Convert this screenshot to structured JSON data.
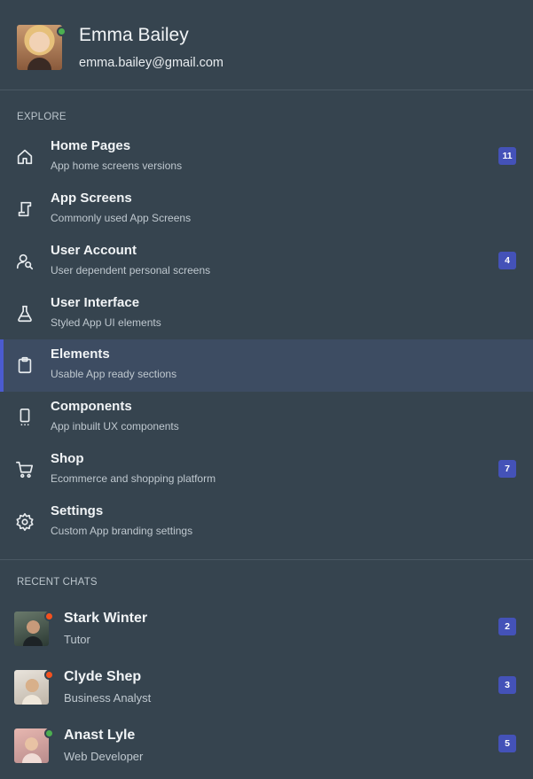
{
  "profile": {
    "name": "Emma Bailey",
    "email": "emma.bailey@gmail.com",
    "status_color": "#4caf50"
  },
  "explore": {
    "label": "EXPLORE",
    "items": [
      {
        "icon": "home-icon",
        "title": "Home Pages",
        "subtitle": "App home screens versions",
        "badge": "11"
      },
      {
        "icon": "screen-icon",
        "title": "App Screens",
        "subtitle": "Commonly used App Screens",
        "badge": ""
      },
      {
        "icon": "user-search-icon",
        "title": "User Account",
        "subtitle": "User dependent personal screens",
        "badge": "4"
      },
      {
        "icon": "flask-icon",
        "title": "User Interface",
        "subtitle": "Styled App UI elements",
        "badge": ""
      },
      {
        "icon": "clipboard-icon",
        "title": "Elements",
        "subtitle": "Usable App ready sections",
        "badge": "",
        "active": true
      },
      {
        "icon": "mobile-icon",
        "title": "Components",
        "subtitle": "App inbuilt UX components",
        "badge": ""
      },
      {
        "icon": "cart-icon",
        "title": "Shop",
        "subtitle": "Ecommerce and shopping platform",
        "badge": "7"
      },
      {
        "icon": "gear-icon",
        "title": "Settings",
        "subtitle": "Custom App branding settings",
        "badge": ""
      }
    ]
  },
  "recent_chats": {
    "label": "RECENT CHATS",
    "items": [
      {
        "name": "Stark Winter",
        "role": "Tutor",
        "badge": "2",
        "status_color": "#f4511e"
      },
      {
        "name": "Clyde Shep",
        "role": "Business Analyst",
        "badge": "3",
        "status_color": "#f4511e"
      },
      {
        "name": "Anast Lyle",
        "role": "Web Developer",
        "badge": "5",
        "status_color": "#4caf50"
      }
    ]
  },
  "colors": {
    "background": "#36444f",
    "active_row": "#3d4c62",
    "accent": "#4b5bd0",
    "badge": "#4452b8"
  }
}
